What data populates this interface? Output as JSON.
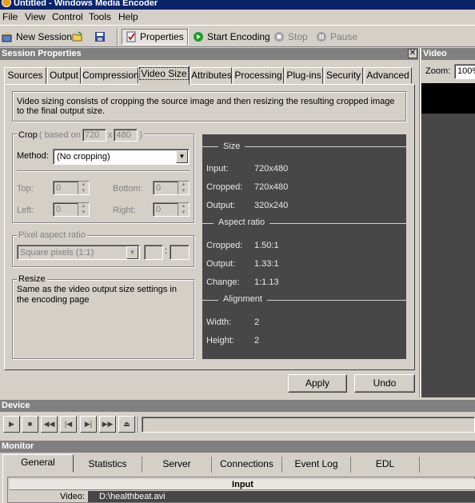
{
  "window": {
    "title": "Untitled - Windows Media Encoder"
  },
  "menu": [
    "File",
    "View",
    "Control",
    "Tools",
    "Help"
  ],
  "toolbar": {
    "new_session": "New Session",
    "properties": "Properties",
    "start_encoding": "Start Encoding",
    "stop": "Stop",
    "pause": "Pause"
  },
  "session": {
    "header": "Session Properties",
    "tabs": [
      "Sources",
      "Output",
      "Compression",
      "Video Size",
      "Attributes",
      "Processing",
      "Plug-ins",
      "Security",
      "Advanced"
    ],
    "active_tab": "Video Size",
    "description": "Video sizing consists of cropping the source image and then resizing the resulting cropped image to the final output size.",
    "crop": {
      "legend": "Crop",
      "based_on_label": "( based on",
      "based_w": "720",
      "x_label": "x",
      "based_h": "480",
      "close_paren": ")",
      "method_label": "Method:",
      "method_value": "(No cropping)",
      "top_label": "Top:",
      "top_value": "0",
      "bottom_label": "Bottom:",
      "bottom_value": "0",
      "left_label": "Left:",
      "left_value": "0",
      "right_label": "Right:",
      "right_value": "0"
    },
    "pixel_aspect": {
      "legend": "Pixel aspect ratio",
      "value": "Square pixels (1:1)",
      "colon": ":"
    },
    "resize": {
      "legend": "Resize",
      "text": "Same as the video output size settings in the encoding page"
    },
    "summary": {
      "size_title": "Size",
      "input_label": "Input:",
      "input_value": "720x480",
      "cropped_label": "Cropped:",
      "cropped_value": "720x480",
      "output_label": "Output:",
      "output_value": "320x240",
      "aspect_title": "Aspect ratio",
      "ar_cropped_label": "Cropped:",
      "ar_cropped_value": "1.50:1",
      "ar_output_label": "Output:",
      "ar_output_value": "1.33:1",
      "ar_change_label": "Change:",
      "ar_change_value": "1:1.13",
      "alignment_title": "Alignment",
      "width_label": "Width:",
      "width_value": "2",
      "height_label": "Height:",
      "height_value": "2"
    },
    "apply": "Apply",
    "undo": "Undo"
  },
  "video_panel": {
    "header": "Video",
    "zoom_label": "Zoom:",
    "zoom_value": "100%"
  },
  "device": {
    "header": "Device"
  },
  "monitor": {
    "header": "Monitor",
    "tabs": [
      "General",
      "Statistics",
      "Server",
      "Connections",
      "Event Log",
      "EDL"
    ],
    "active_tab": "General",
    "input_header": "Input",
    "video_label": "Video:",
    "video_value": "D:\\healthbeat.avi"
  },
  "colors": {
    "title_bar": "#0a246a",
    "summary_bg": "#474747",
    "panel_header": "#808080"
  }
}
